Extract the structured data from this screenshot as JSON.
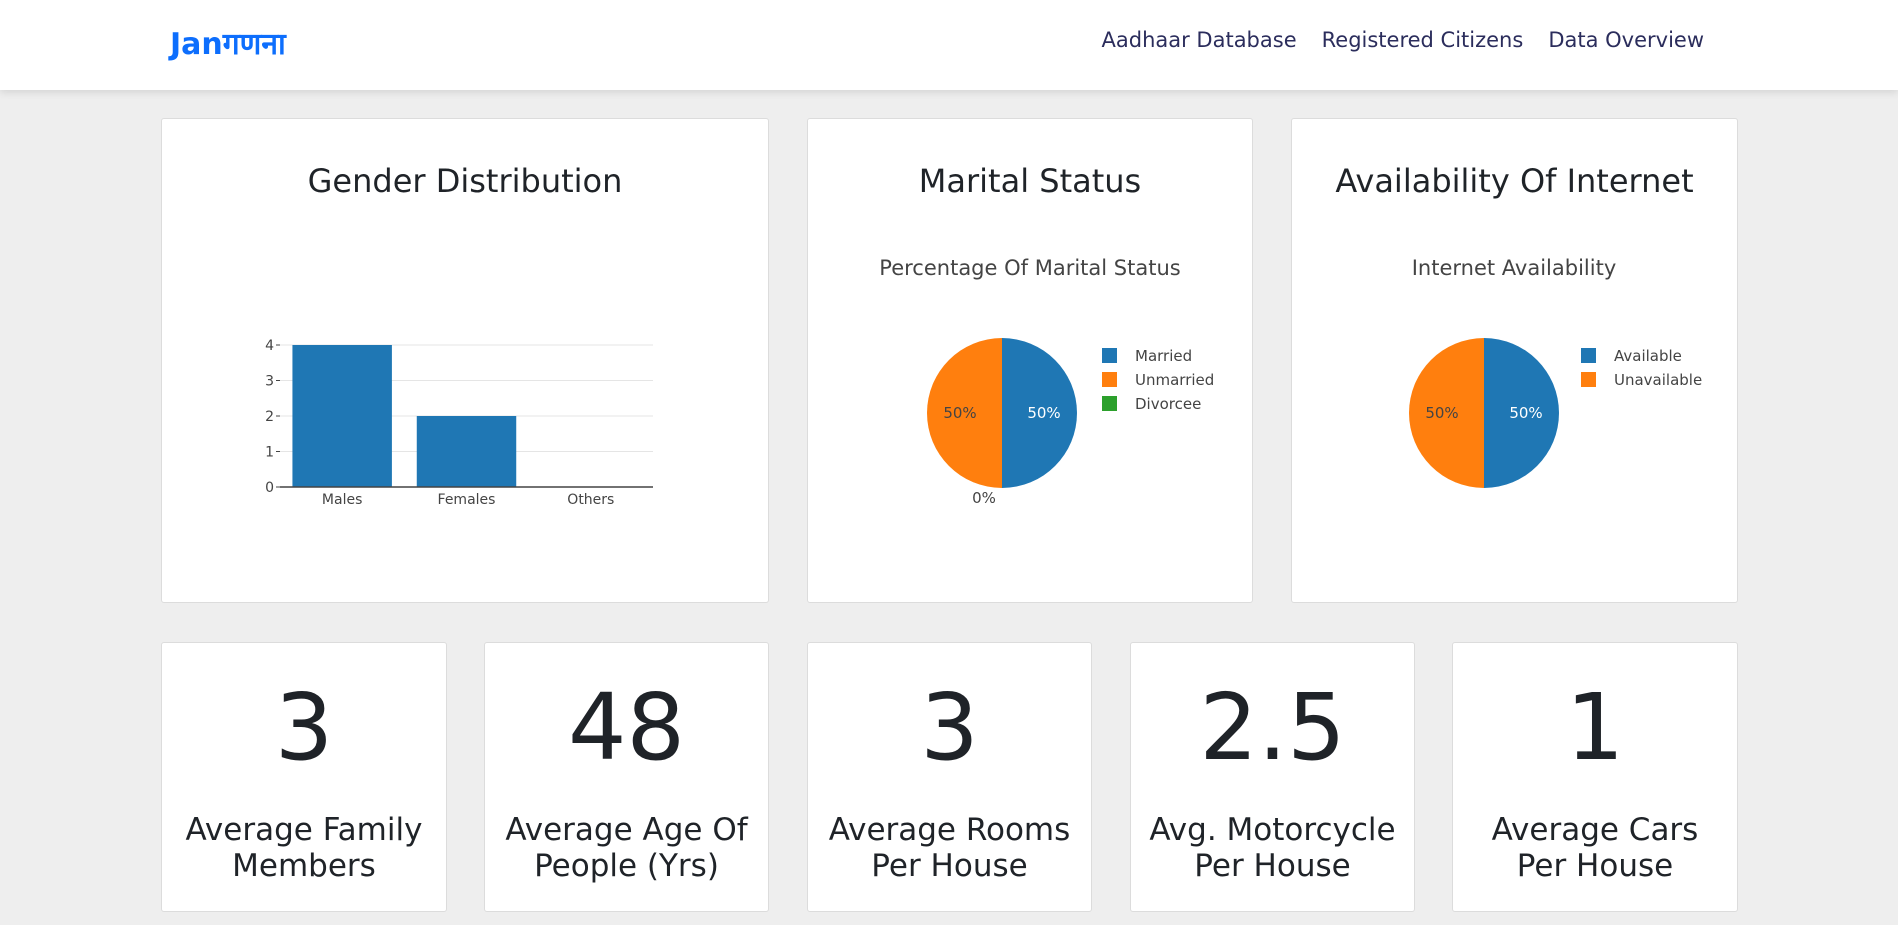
{
  "navbar": {
    "brand": "Janगणना",
    "links": [
      "Aadhaar Database",
      "Registered Citizens",
      "Data Overview"
    ]
  },
  "cards": {
    "gender": {
      "title": "Gender Distribution"
    },
    "marital": {
      "title": "Marital Status"
    },
    "internet": {
      "title": "Availability Of Internet"
    }
  },
  "stats": [
    {
      "value": "3",
      "label_line1": "Average Family",
      "label_line2": "Members"
    },
    {
      "value": "48",
      "label_line1": "Average Age Of",
      "label_line2": "People (Yrs)"
    },
    {
      "value": "3",
      "label_line1": "Average Rooms",
      "label_line2": "Per House"
    },
    {
      "value": "2.5",
      "label_line1": "Avg. Motorcycle",
      "label_line2": "Per House"
    },
    {
      "value": "1",
      "label_line1": "Average Cars",
      "label_line2": "Per House"
    }
  ],
  "chart_data": [
    {
      "type": "bar",
      "title": "",
      "categories": [
        "Males",
        "Females",
        "Others"
      ],
      "values": [
        4,
        2,
        0
      ],
      "ylim": [
        0,
        4
      ],
      "yticks": [
        0,
        1,
        2,
        3,
        4
      ],
      "color": "#1f77b4",
      "grid": true
    },
    {
      "type": "pie",
      "title": "Percentage Of Marital Status",
      "labels": [
        "Married",
        "Unmarried",
        "Divorcee"
      ],
      "values": [
        50,
        50,
        0
      ],
      "slice_labels": [
        "50%",
        "50%",
        "0%"
      ],
      "colors": [
        "#1f77b4",
        "#ff7f0e",
        "#2ca02c"
      ],
      "legend": "right"
    },
    {
      "type": "pie",
      "title": "Internet Availability",
      "labels": [
        "Available",
        "Unavailable"
      ],
      "values": [
        50,
        50
      ],
      "slice_labels": [
        "50%",
        "50%"
      ],
      "colors": [
        "#1f77b4",
        "#ff7f0e"
      ],
      "legend": "right"
    }
  ]
}
